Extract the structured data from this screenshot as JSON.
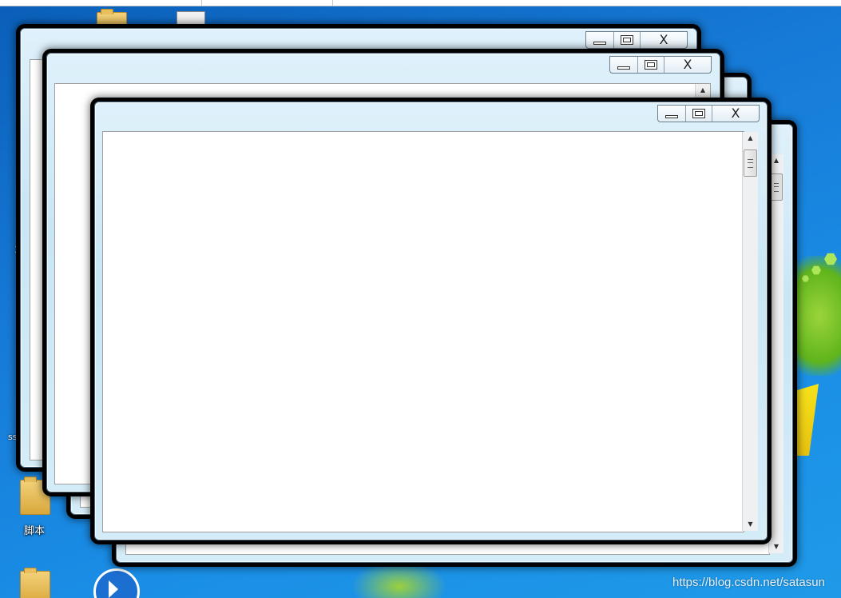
{
  "desktop": {
    "icons": [
      {
        "label": ""
      },
      {
        "label": "脚本"
      },
      {
        "label": ""
      }
    ],
    "fragments": [
      "3",
      "ss"
    ]
  },
  "windows": [
    {
      "title": "",
      "minimize_label": "",
      "maximize_label": "",
      "close_label": "X"
    },
    {
      "title": "",
      "minimize_label": "",
      "maximize_label": "",
      "close_label": "X"
    },
    {
      "title": "",
      "minimize_label": "",
      "maximize_label": "",
      "close_label": "X"
    },
    {
      "title": "",
      "minimize_label": "",
      "maximize_label": "",
      "close_label": "X"
    }
  ],
  "scrollbar": {
    "up_arrow": "▲",
    "down_arrow": "▼"
  },
  "watermark": "https://blog.csdn.net/satasun",
  "colors": {
    "glass": "#d4ecf8",
    "desktop": "#1679d6",
    "client": "#ffffff"
  }
}
